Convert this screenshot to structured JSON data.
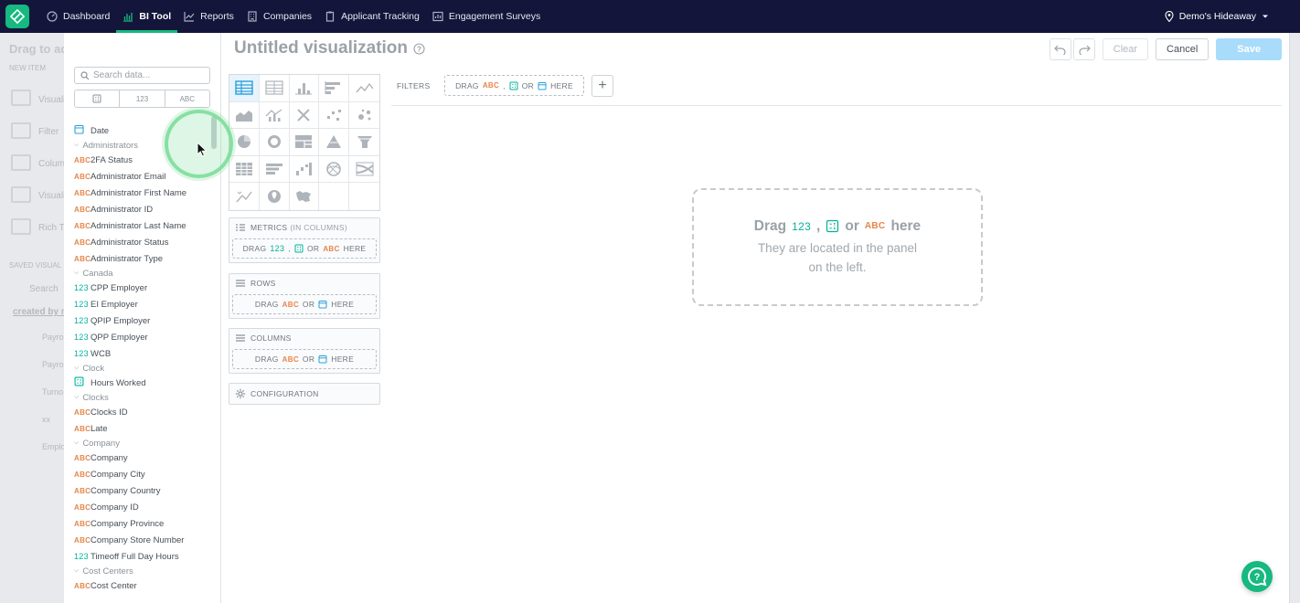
{
  "nav": {
    "items": [
      {
        "label": "Dashboard",
        "icon": "dashboard-icon"
      },
      {
        "label": "BI Tool",
        "icon": "chart-icon",
        "active": true
      },
      {
        "label": "Reports",
        "icon": "line-chart-icon"
      },
      {
        "label": "Companies",
        "icon": "building-icon"
      },
      {
        "label": "Applicant Tracking",
        "icon": "clipboard-icon"
      },
      {
        "label": "Engagement Surveys",
        "icon": "survey-icon"
      }
    ],
    "location": "Demo's Hideaway"
  },
  "backdrop": {
    "drag_title": "Drag to ad",
    "new_item": "NEW ITEM",
    "items": [
      "Visuali",
      "Filter",
      "Colum",
      "Visuali",
      "Rich Te"
    ],
    "saved_label": "SAVED VISUAL",
    "search": "Search",
    "created_by": "created by m",
    "saved": [
      "Payrol",
      "Payrol",
      "Turno",
      "xx",
      "Emplo"
    ]
  },
  "data_panel": {
    "search_placeholder": "Search data...",
    "type_tabs": [
      "",
      "123",
      "ABC"
    ],
    "date_item": "Date",
    "groups": [
      {
        "name": "Administrators",
        "items": [
          {
            "type": "ABC",
            "label": "2FA Status"
          },
          {
            "type": "ABC",
            "label": "Administrator Email"
          },
          {
            "type": "ABC",
            "label": "Administrator First Name"
          },
          {
            "type": "ABC",
            "label": "Administrator ID"
          },
          {
            "type": "ABC",
            "label": "Administrator Last Name"
          },
          {
            "type": "ABC",
            "label": "Administrator Status"
          },
          {
            "type": "ABC",
            "label": "Administrator Type"
          }
        ]
      },
      {
        "name": "Canada",
        "items": [
          {
            "type": "123",
            "label": "CPP Employer"
          },
          {
            "type": "123",
            "label": "EI Employer"
          },
          {
            "type": "123",
            "label": "QPIP Employer"
          },
          {
            "type": "123",
            "label": "QPP Employer"
          },
          {
            "type": "123",
            "label": "WCB"
          }
        ]
      },
      {
        "name": "Clock",
        "items": [
          {
            "type": "calc",
            "label": "Hours Worked"
          }
        ]
      },
      {
        "name": "Clocks",
        "items": [
          {
            "type": "ABC",
            "label": "Clocks ID"
          },
          {
            "type": "ABC",
            "label": "Late"
          }
        ]
      },
      {
        "name": "Company",
        "items": [
          {
            "type": "ABC",
            "label": "Company"
          },
          {
            "type": "ABC",
            "label": "Company City"
          },
          {
            "type": "ABC",
            "label": "Company Country"
          },
          {
            "type": "ABC",
            "label": "Company ID"
          },
          {
            "type": "ABC",
            "label": "Company Province"
          },
          {
            "type": "ABC",
            "label": "Company Store Number"
          },
          {
            "type": "123",
            "label": "Timeoff Full Day Hours"
          }
        ]
      },
      {
        "name": "Cost Centers",
        "items": [
          {
            "type": "ABC",
            "label": "Cost Center"
          }
        ]
      }
    ]
  },
  "viz": {
    "title": "Untitled visualization",
    "clear": "Clear",
    "cancel": "Cancel",
    "save": "Save",
    "filters_label": "FILTERS",
    "drag": "DRAG",
    "or": "OR",
    "here": "HERE",
    "comma": ",",
    "metrics_label": "METRICS",
    "metrics_sub": "(IN COLUMNS)",
    "rows_label": "ROWS",
    "columns_label": "COLUMNS",
    "configuration_label": "CONFIGURATION",
    "canvas_drag": "Drag",
    "canvas_or": "or",
    "canvas_here": "here",
    "canvas_hint": "They are located in the panel on the left.",
    "num_tag": "123",
    "abc_tag": "ABC",
    "palette": [
      "table-icon",
      "pivot-icon",
      "column-chart-icon",
      "bar-chart-icon",
      "line-chart-icon",
      "area-chart-icon",
      "combo-chart-icon",
      "headline-icon",
      "scatter-icon",
      "bubble-icon",
      "pie-icon",
      "donut-icon",
      "treemap-icon",
      "pyramid-icon",
      "funnel-icon",
      "heatmap-icon",
      "bullet-icon",
      "waterfall-icon",
      "dependency-wheel-icon",
      "sankey-icon",
      "repeater-icon",
      "geo-pushpin-icon",
      "geo-area-icon",
      "",
      ""
    ]
  },
  "colors": {
    "nav_bg": "#13163a",
    "accent": "#16b980",
    "save_disabled": "#a8dcfa",
    "abc": "#e6864a",
    "num": "#00b29a"
  }
}
